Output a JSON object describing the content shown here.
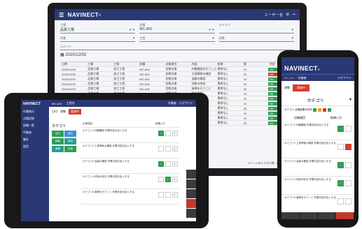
{
  "app": {
    "brand": "NAVINECT",
    "brand_mark": "®"
  },
  "desktop": {
    "header_right": [
      "ユーザー名",
      "⊞",
      "⇥"
    ],
    "filters": [
      {
        "label": "工場",
        "value": "品質工場"
      },
      {
        "label": "設備",
        "value": "MC-A01"
      },
      {
        "label": "カテゴリ",
        "value": ""
      },
      {
        "label": "作業",
        "value": ""
      },
      {
        "label": "工程",
        "value": ""
      },
      {
        "label": "状態",
        "value": ""
      }
    ],
    "comment_label": "コメント",
    "date": "2020/12/02",
    "table_headers": [
      "日時",
      "工場",
      "工程",
      "設備",
      "点検項目",
      "内容",
      "結果",
      "値",
      "判定"
    ],
    "table_rows": [
      [
        "2020/12/02",
        "品質工場",
        "加工工程",
        "MC-A01",
        "定期点検",
        "外観確認を行うこと",
        "異常なし",
        "10",
        "OK"
      ],
      [
        "2020/12/02",
        "品質工場",
        "加工工程",
        "MC-A01",
        "定期点検",
        "工具摩耗の確認",
        "異常なし",
        "20",
        "NG"
      ],
      [
        "2020/12/02",
        "品質工場",
        "加工工程",
        "MC-A01",
        "定期点検",
        "油量の確認",
        "異常なし",
        "10",
        "OK"
      ],
      [
        "2020/12/02",
        "品質工場",
        "加工工程",
        "MC-A01",
        "定期点検",
        "切粉の除去",
        "異常なし",
        "10",
        "OK"
      ],
      [
        "2020/12/02",
        "品質工場",
        "加工工程",
        "MC-A01",
        "定期点検",
        "清掃を行うこと",
        "異常なし",
        "20",
        "OK"
      ],
      [
        "2020/12/02",
        "品質工場",
        "加工工程",
        "MC-A01",
        "定期点検",
        "動作確認",
        "異常なし",
        "10",
        "OK"
      ],
      [
        "2020/12/02",
        "品質工場",
        "加工工程",
        "MC-A01",
        "定期点検",
        "圧力の確認",
        "異常なし",
        "10",
        "OK"
      ],
      [
        "2020/12/02",
        "品質工場",
        "加工工程",
        "MC-A01",
        "定期点検",
        "温度の確認",
        "異常なし",
        "10",
        "OK"
      ],
      [
        "2020/12/02",
        "品質工場",
        "加工工程",
        "MC-A01",
        "定期点検",
        "振動の確認",
        "異常なし",
        "20",
        "OK"
      ],
      [
        "2020/12/02",
        "品質工場",
        "加工工程",
        "MC-A01",
        "定期点検",
        "異音の確認",
        "異常なし",
        "10",
        "OK"
      ],
      [
        "2020/12/02",
        "品質工場",
        "加工工程",
        "MC-A01",
        "定期点検",
        "漏れの確認",
        "異常なし",
        "10",
        "OK"
      ],
      [
        "2020/12/02",
        "品質工場",
        "加工工程",
        "MC-A01",
        "定期点検",
        "締付の確認",
        "異常なし",
        "20",
        "OK"
      ]
    ],
    "pagination": "1ページあたりの行数: 10   1-10 of 100"
  },
  "tablet": {
    "sidebar": [
      "作業指示",
      "点検記録",
      "設備一覧",
      "作業者",
      "集計",
      "設定"
    ],
    "top_items": [
      "MC-A01",
      "工程名",
      "作業者",
      "ログアウト"
    ],
    "sub_items": [
      "日付",
      "状態",
      "実施中"
    ],
    "category_title": "カテゴリ",
    "categories": [
      "加工",
      "組立",
      "検査",
      "保全",
      "清掃",
      "出荷"
    ],
    "list_header": [
      "点検項目",
      "結果入力"
    ],
    "items": [
      "カテゴリ1 外観確認 作業内容を記入する",
      "カテゴリ2 工具摩耗の確認 作業内容を記入する",
      "カテゴリ3 油量の確認 作業内容を記入する",
      "カテゴリ4 切粉の除去 作業内容を記入する",
      "カテゴリ5 清掃を行うこと 作業内容を記入する"
    ]
  },
  "phone": {
    "sub_items": [
      "MC-A01",
      "作業者",
      "ログアウト"
    ],
    "toolbar_label": "状態",
    "toolbar_button": "実施中",
    "category": "カテゴリ",
    "summary": "カテゴリ 点検結果の状況",
    "columns": [
      "点検項目",
      "結果入力"
    ],
    "items": [
      "カテゴリ1 外観確認 作業内容を記入する",
      "カテゴリ2 工具摩耗の確認 作業内容を記入する",
      "カテゴリ3 油量の確認 作業内容を記入する",
      "カテゴリ4 切粉の除去 作業内容を記入する",
      "カテゴリ5 清掃を行うこと 作業内容を記入する"
    ]
  },
  "colors": {
    "navy": "#2a3875",
    "green": "#2e9e55",
    "red": "#d63c2f",
    "blue": "#3d8fd6"
  }
}
